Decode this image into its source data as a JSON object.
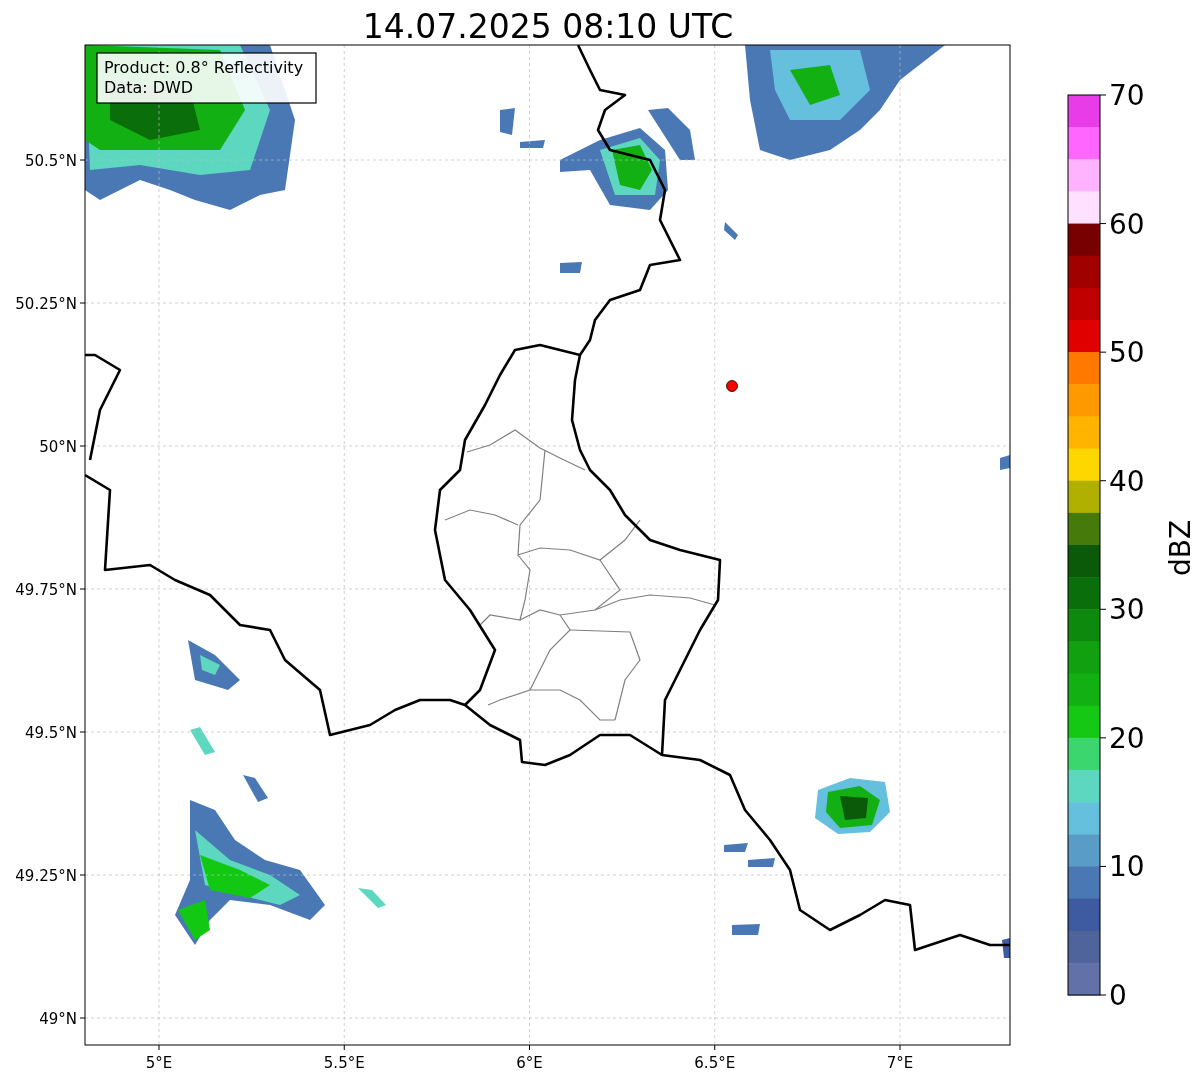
{
  "title": "14.07.2025 08:10 UTC",
  "map": {
    "legend": [
      "Product: 0.8° Reflectivity",
      "Data: DWD"
    ],
    "xticks": [
      "5°E",
      "5.5°E",
      "6°E",
      "6.5°E",
      "7°E"
    ],
    "yticks": [
      "50.5°N",
      "50.25°N",
      "50°N",
      "49.75°N",
      "49.5°N",
      "49.25°N",
      "49°N"
    ],
    "station": {
      "color": "#ff0000"
    }
  },
  "colorbar": {
    "label": "dBZ",
    "ticks": [
      "70",
      "60",
      "50",
      "40",
      "30",
      "20",
      "10",
      "0"
    ],
    "segments": [
      {
        "color": "#e83ce8"
      },
      {
        "color": "#ff66ff"
      },
      {
        "color": "#ffb3ff"
      },
      {
        "color": "#ffe0ff"
      },
      {
        "color": "#780000"
      },
      {
        "color": "#a00000"
      },
      {
        "color": "#c00000"
      },
      {
        "color": "#e00000"
      },
      {
        "color": "#ff7800"
      },
      {
        "color": "#ff9900"
      },
      {
        "color": "#ffb400"
      },
      {
        "color": "#ffd700"
      },
      {
        "color": "#b0b000"
      },
      {
        "color": "#467a0a"
      },
      {
        "color": "#0a5a0a"
      },
      {
        "color": "#0a6e0a"
      },
      {
        "color": "#0d8a0d"
      },
      {
        "color": "#10a010"
      },
      {
        "color": "#12b012"
      },
      {
        "color": "#14c814"
      },
      {
        "color": "#3cd66e"
      },
      {
        "color": "#5ed7c0"
      },
      {
        "color": "#64c0dc"
      },
      {
        "color": "#5a9cc8"
      },
      {
        "color": "#4a78b4"
      },
      {
        "color": "#3e5aa0"
      },
      {
        "color": "#50649c"
      },
      {
        "color": "#6272a8"
      }
    ]
  }
}
